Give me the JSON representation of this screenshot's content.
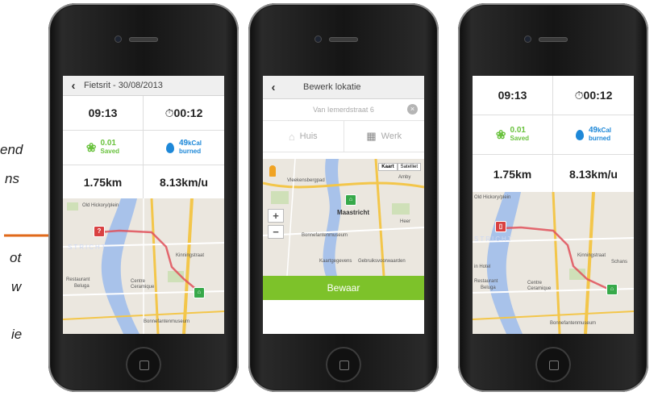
{
  "side_text": [
    "end",
    "ns",
    "ot",
    "w",
    "ie"
  ],
  "colors": {
    "accent_green": "#7dc22a",
    "stat_green": "#6ac23e",
    "stat_blue": "#1e88d8",
    "route_red": "#e0505a",
    "arrow_orange": "#e06a1b"
  },
  "phone1": {
    "nav_title": "Fietsrit - 30/08/2013",
    "time": "09:13",
    "duration": "00:12",
    "saved_value": "0.01",
    "saved_label": "Saved",
    "kcal_value": "49",
    "kcal_unit": "kCal",
    "kcal_label": "burned",
    "distance": "1.75km",
    "speed": "8.13km/u",
    "map_labels": [
      "Old Hickory/plein",
      "STRICHT",
      "Kinningstraat",
      "Restaurant",
      "Beluga",
      "Centre",
      "Ceramique",
      "Bonnefantenmuseum",
      "Maastricht"
    ],
    "pin_question": "?"
  },
  "phone2": {
    "nav_title": "Bewerk lokatie",
    "address_value": "Van Iemerdstraat 6",
    "place_home": "Huis",
    "place_work": "Werk",
    "map_type_map": "Kaart",
    "map_type_satellite": "Satelliet",
    "zoom_in": "+",
    "zoom_out": "−",
    "map_labels": [
      "Maastricht",
      "Bonnefantenmuseum",
      "Kaartgegevens",
      "Gebruiksvoorwaarden",
      "Amby",
      "Vleekensbergpad",
      "Heer"
    ],
    "save_label": "Bewaar"
  },
  "phone3": {
    "time": "09:13",
    "duration": "00:12",
    "saved_value": "0.01",
    "saved_label": "Saved",
    "kcal_value": "49",
    "kcal_unit": "kCal",
    "kcal_label": "burned",
    "distance": "1.75km",
    "speed": "8.13km/u",
    "map_labels": [
      "Old Hickory/plein",
      "STRICHT",
      "Kinningstraat",
      "Restaurant",
      "Beluga",
      "Centre",
      "Ceramique",
      "Bonnefantenmuseum",
      "in Hotel",
      "Schans"
    ]
  }
}
